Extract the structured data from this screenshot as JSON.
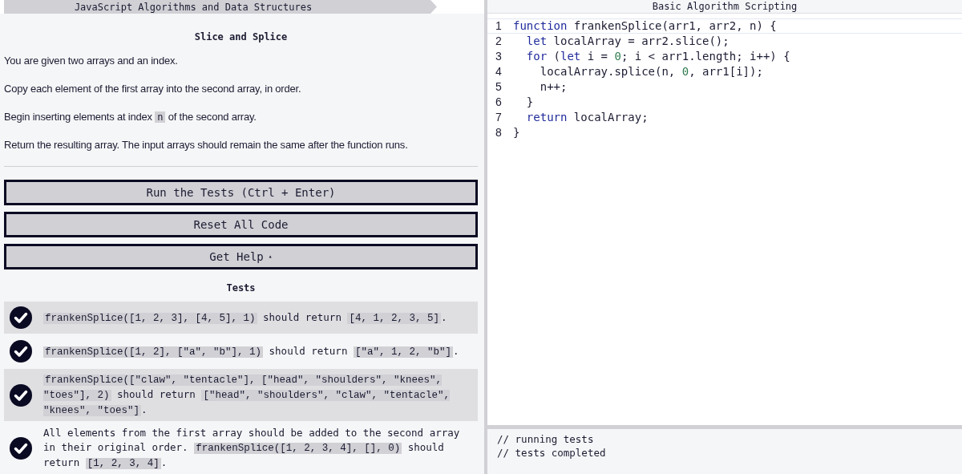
{
  "breadcrumbs": [
    {
      "text": "JavaScript Algorithms and Data Structures"
    },
    {
      "text": "Basic Algorithm Scripting"
    }
  ],
  "challenge": {
    "title": "Slice and Splice",
    "description": [
      [
        {
          "kind": "text",
          "text": "You are given two arrays and an index."
        }
      ],
      [
        {
          "kind": "text",
          "text": "Copy each element of the first array into the second array, in order."
        }
      ],
      [
        {
          "kind": "text",
          "text": "Begin inserting elements at index "
        },
        {
          "kind": "code",
          "text": "n"
        },
        {
          "kind": "text",
          "text": " of the second array."
        }
      ],
      [
        {
          "kind": "text",
          "text": "Return the resulting array. The input arrays should remain the same after the function runs."
        }
      ]
    ]
  },
  "buttons": [
    {
      "label": "Run the Tests (Ctrl + Enter)"
    },
    {
      "label": "Reset All Code"
    },
    {
      "label": "Get Help",
      "caret": "▴"
    }
  ],
  "tests_heading": "Tests",
  "tests": [
    {
      "passed": true,
      "segments": [
        {
          "kind": "code",
          "text": "frankenSplice([1, 2, 3], [4, 5], 1)"
        },
        {
          "kind": "text",
          "text": " should return "
        },
        {
          "kind": "code",
          "text": "[4, 1, 2, 3, 5]"
        },
        {
          "kind": "text",
          "text": "."
        }
      ]
    },
    {
      "passed": true,
      "segments": [
        {
          "kind": "code",
          "text": "frankenSplice([1, 2], [\"a\", \"b\"], 1)"
        },
        {
          "kind": "text",
          "text": " should return "
        },
        {
          "kind": "code",
          "text": "[\"a\", 1, 2, \"b\"]"
        },
        {
          "kind": "text",
          "text": "."
        }
      ]
    },
    {
      "passed": true,
      "segments": [
        {
          "kind": "code",
          "text": "frankenSplice([\"claw\", \"tentacle\"], [\"head\", \"shoulders\", \"knees\", \"toes\"], 2)"
        },
        {
          "kind": "text",
          "text": " should return "
        },
        {
          "kind": "code",
          "text": "[\"head\", \"shoulders\", \"claw\", \"tentacle\", \"knees\", \"toes\"]"
        },
        {
          "kind": "text",
          "text": "."
        }
      ]
    },
    {
      "passed": true,
      "segments": [
        {
          "kind": "text",
          "text": "All elements from the first array should be added to the second array in their original order. "
        },
        {
          "kind": "code",
          "text": "frankenSplice([1, 2, 3, 4], [], 0)"
        },
        {
          "kind": "text",
          "text": " should return "
        },
        {
          "kind": "code",
          "text": "[1, 2, 3, 4]"
        },
        {
          "kind": "text",
          "text": "."
        }
      ]
    }
  ],
  "editor": {
    "lines": [
      {
        "number": "1",
        "tokens": [
          {
            "kind": "keyword",
            "text": "function"
          },
          {
            "kind": "plain",
            "text": " frankenSplice(arr1, arr2, n) {"
          }
        ]
      },
      {
        "number": "2",
        "tokens": [
          {
            "kind": "keyword",
            "text": "  let"
          },
          {
            "kind": "plain",
            "text": " localArray = arr2.slice();"
          }
        ]
      },
      {
        "number": "3",
        "tokens": [
          {
            "kind": "keyword",
            "text": "  for"
          },
          {
            "kind": "plain",
            "text": " ("
          },
          {
            "kind": "keyword",
            "text": "let"
          },
          {
            "kind": "plain",
            "text": " i = "
          },
          {
            "kind": "number",
            "text": "0"
          },
          {
            "kind": "plain",
            "text": "; i < arr1.length; i++) {"
          }
        ]
      },
      {
        "number": "4",
        "tokens": [
          {
            "kind": "plain",
            "text": "    localArray.splice(n, "
          },
          {
            "kind": "number",
            "text": "0"
          },
          {
            "kind": "plain",
            "text": ", arr1[i]);"
          }
        ]
      },
      {
        "number": "5",
        "tokens": [
          {
            "kind": "plain",
            "text": "    n++;"
          }
        ]
      },
      {
        "number": "6",
        "tokens": [
          {
            "kind": "plain",
            "text": "  }"
          }
        ]
      },
      {
        "number": "7",
        "tokens": [
          {
            "kind": "keyword",
            "text": "  return"
          },
          {
            "kind": "plain",
            "text": " localArray;"
          }
        ]
      },
      {
        "number": "8",
        "tokens": [
          {
            "kind": "plain",
            "text": "}"
          }
        ]
      }
    ]
  },
  "console": {
    "lines": [
      "// running tests",
      "// tests completed"
    ]
  }
}
